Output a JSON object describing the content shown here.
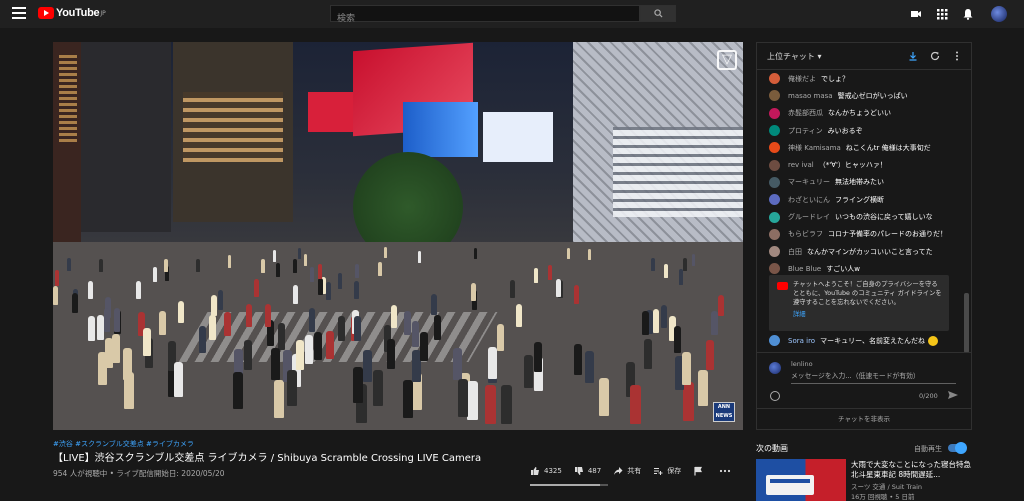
{
  "header": {
    "logo_text": "YouTube",
    "logo_region": "JP",
    "search_placeholder": "検索"
  },
  "video": {
    "hashtags": "#渋谷 #スクランブル交差点 #ライブカメラ",
    "title": "【LIVE】渋谷スクランブル交差点 ライブカメラ / Shibuya Scramble Crossing LIVE Camera",
    "meta": "954 人が視聴中 • ライブ配信開始日: 2020/05/20",
    "watermark": "ANN NEWS",
    "like_count": "4325",
    "dislike_count": "487",
    "share_label": "共有",
    "save_label": "保存",
    "like_ratio": 0.9
  },
  "chat": {
    "header_title": "上位チャット ▾",
    "messages": [
      {
        "author": "俺様だよ",
        "text": "でしょ？",
        "color": "#d45d3a"
      },
      {
        "author": "masao masa",
        "text": "警戒心ゼロがいっぱい",
        "color": "#7a5c3c"
      },
      {
        "author": "赤髭部西瓜",
        "text": "なんかちょうどいい",
        "color": "#c2185b"
      },
      {
        "author": "プロティン",
        "text": "みいおるぞ",
        "color": "#00897b"
      },
      {
        "author": "神様 Kamisama",
        "text": "ねこくんtr 俺様は大事旬だ",
        "color": "#e64a19"
      },
      {
        "author": "rev ival",
        "text": "（*'∀'）ヒャッハァ！",
        "color": "#6d4c41"
      },
      {
        "author": "マーキュリー",
        "text": "無法地帯みたい",
        "color": "#455a64"
      },
      {
        "author": "わざといにん",
        "text": "フライング横断",
        "color": "#5c6bc0"
      },
      {
        "author": "グルードレイ",
        "text": "いつもの渋谷に戻って嬉しいな",
        "color": "#26a69a"
      },
      {
        "author": "もらビラフ",
        "text": "コロナ予備率のパレードのお通りだ！",
        "color": "#8d6e63"
      },
      {
        "author": "白田",
        "text": "なんかマインがカッコいいこと言ってた",
        "color": "#a1887f"
      },
      {
        "author": "Blue Blue",
        "text": "すごい人w",
        "color": "#795548"
      }
    ],
    "notice_text": "チャットへようこそ！ご自身のプライバシーを守るとともに、YouTube のコミュニティ ガイドラインを遵守することを忘れないでください。",
    "notice_link": "詳細",
    "last_author": "Sora iro",
    "last_text": "マーキュリー、名前変えたんだね",
    "user_name": "lenlino",
    "input_placeholder": "メッセージを入力...（低速モードが有効）",
    "char_counter": "0/200",
    "hide_chat_label": "チャットを非表示"
  },
  "sidebar": {
    "upnext_label": "次の動画",
    "autoplay_label": "自動再生",
    "video_title": "大雨で大変なことになった寝台特急北斗星東車記 8時間遅延...",
    "video_channel": "スーツ 交通 / Suit Train",
    "video_stats": "16万 回視聴 • 5 日前"
  }
}
